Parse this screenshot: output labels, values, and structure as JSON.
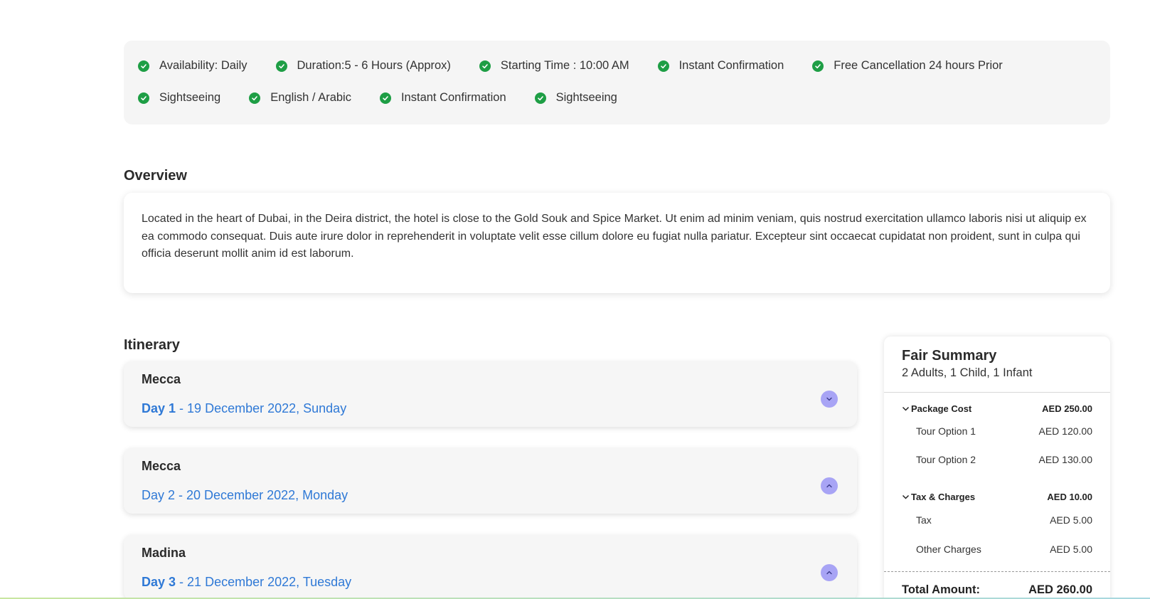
{
  "features": {
    "row1": [
      {
        "label": "Availability: Daily"
      },
      {
        "label": "Duration:5 - 6 Hours (Approx)"
      },
      {
        "label": "Starting Time : 10:00 AM"
      },
      {
        "label": "Instant Confirmation"
      },
      {
        "label": "Free Cancellation 24 hours Prior"
      }
    ],
    "row2": [
      {
        "label": "Sightseeing"
      },
      {
        "label": "English / Arabic"
      },
      {
        "label": "Instant Confirmation"
      },
      {
        "label": "Sightseeing"
      }
    ],
    "icon": "check-circle-icon"
  },
  "overview": {
    "title": "Overview",
    "text": "Located in the heart of Dubai, in the Deira district, the hotel is close to the Gold Souk and Spice Market. Ut enim ad minim veniam, quis nostrud exercitation ullamco laboris nisi ut aliquip ex ea commodo consequat. Duis aute irure dolor in reprehenderit in voluptate velit esse cillum dolore eu fugiat nulla pariatur. Excepteur sint occaecat cupidatat non proident, sunt in culpa qui officia deserunt mollit anim id est laborum."
  },
  "itinerary": {
    "title": "Itinerary",
    "days": [
      {
        "city": "Mecca",
        "day": "Day 1",
        "date": " - 19 December 2022, Sunday",
        "toggle": "chevron-down-icon"
      },
      {
        "city": "Mecca",
        "day": "Day 2",
        "date": " - 20 December 2022, Monday",
        "toggle": "chevron-up-icon"
      },
      {
        "city": "Madina",
        "day": "Day 3",
        "date": " - 21 December 2022, Tuesday",
        "toggle": "chevron-up-icon"
      }
    ]
  },
  "summary": {
    "title": "Fair Summary",
    "pax": "2 Adults, 1 Child, 1 Infant",
    "package": {
      "label": "Package Cost",
      "amount": "AED 250.00",
      "items": [
        {
          "label": "Tour Option 1",
          "amount": "AED 120.00"
        },
        {
          "label": "Tour Option 2",
          "amount": "AED 130.00"
        }
      ]
    },
    "tax": {
      "label": "Tax & Charges",
      "amount": "AED 10.00",
      "items": [
        {
          "label": "Tax",
          "amount": "AED 5.00"
        },
        {
          "label": "Other Charges",
          "amount": "AED 5.00"
        }
      ]
    },
    "total": {
      "label": "Total Amount:",
      "amount": "AED 260.00"
    }
  },
  "colors": {
    "check": "#1e9e45",
    "link_blue": "#2f79d6",
    "toggle": "#a8a4f5",
    "panel_bg": "#f5f5f5"
  }
}
